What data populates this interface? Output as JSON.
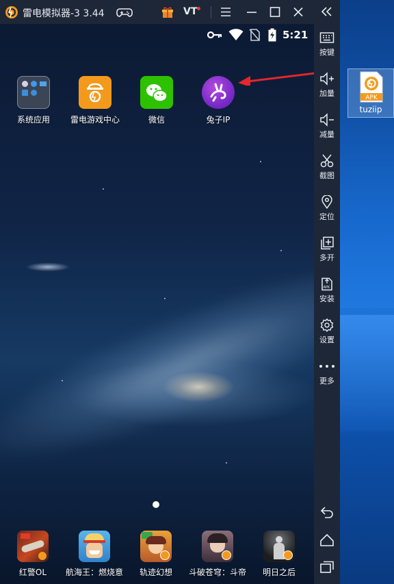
{
  "window": {
    "title": "雷电模拟器-3 3.44",
    "vt_label": "VT"
  },
  "status_bar": {
    "time": "5:21"
  },
  "desktop_apps": [
    {
      "label": "系统应用"
    },
    {
      "label": "雷电游戏中心"
    },
    {
      "label": "微信"
    },
    {
      "label": "兔子IP"
    }
  ],
  "dock_apps": [
    {
      "label": "红警OL"
    },
    {
      "label": "航海王：燃烧意"
    },
    {
      "label": "轨迹幻想"
    },
    {
      "label": "斗破苍穹：斗帝"
    },
    {
      "label": "明日之后"
    }
  ],
  "sidebar": {
    "items": [
      {
        "label": "按键",
        "icon": "keyboard-icon"
      },
      {
        "label": "加量",
        "icon": "volume-up-icon"
      },
      {
        "label": "减量",
        "icon": "volume-down-icon"
      },
      {
        "label": "截图",
        "icon": "scissors-icon"
      },
      {
        "label": "定位",
        "icon": "location-pin-icon"
      },
      {
        "label": "多开",
        "icon": "multi-instance-icon"
      },
      {
        "label": "安装",
        "icon": "apk-install-icon"
      },
      {
        "label": "设置",
        "icon": "gear-icon"
      },
      {
        "label": "更多",
        "icon": "more-dots-icon"
      }
    ]
  },
  "desktop_file": {
    "badge": "APK",
    "name": "tuziip"
  },
  "colors": {
    "chrome": "#1d2737",
    "brand_orange": "#f39a1d",
    "arrow_red": "#e5262c"
  }
}
